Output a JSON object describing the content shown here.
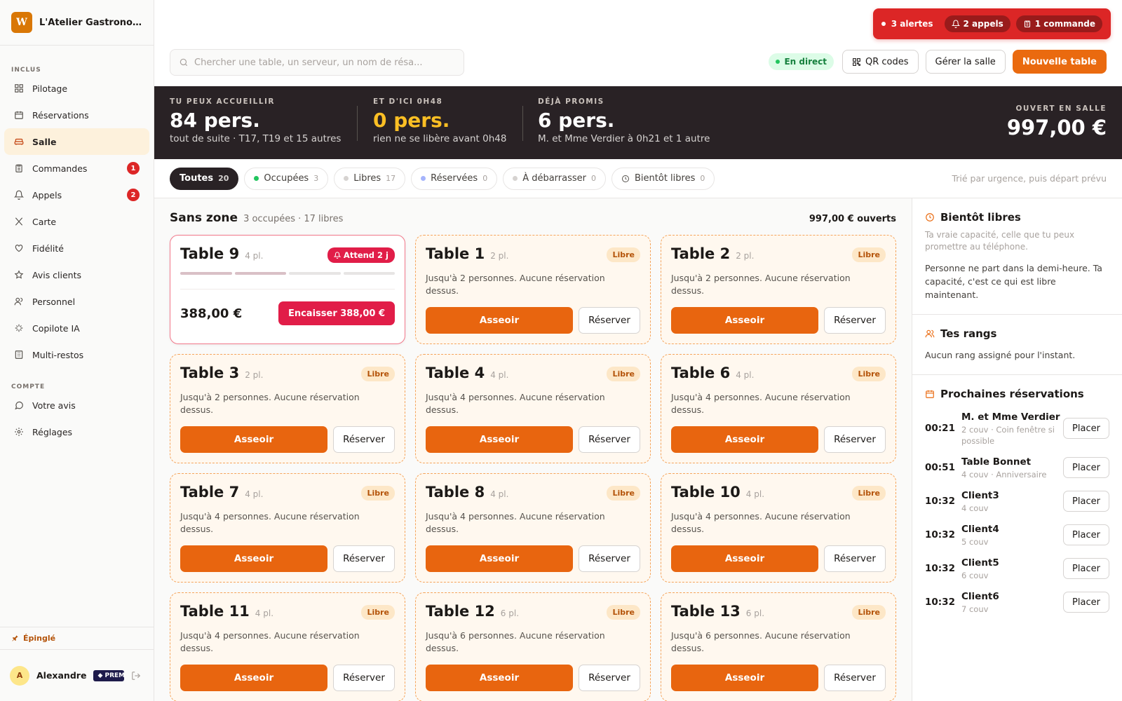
{
  "sidebar": {
    "brand_initial": "W",
    "brand_name": "L'Atelier Gastronomi...",
    "section_included": "INCLUS",
    "items": [
      {
        "label": "Pilotage",
        "icon": "dashboard-icon"
      },
      {
        "label": "Réservations",
        "icon": "calendar-icon"
      },
      {
        "label": "Salle",
        "icon": "sofa-icon"
      },
      {
        "label": "Commandes",
        "icon": "clipboard-icon",
        "badge": "1"
      },
      {
        "label": "Appels",
        "icon": "bell-icon",
        "badge": "2"
      },
      {
        "label": "Carte",
        "icon": "utensils-icon"
      },
      {
        "label": "Fidélité",
        "icon": "heart-icon"
      },
      {
        "label": "Avis clients",
        "icon": "star-icon"
      },
      {
        "label": "Personnel",
        "icon": "users-icon"
      },
      {
        "label": "Copilote IA",
        "icon": "sparkles-icon"
      },
      {
        "label": "Multi-restos",
        "icon": "building-icon"
      }
    ],
    "section_account": "COMPTE",
    "account_items": [
      {
        "label": "Votre avis",
        "icon": "message-icon"
      },
      {
        "label": "Réglages",
        "icon": "gear-icon"
      }
    ],
    "pinned_label": "Épinglé",
    "user_initial": "A",
    "user_name": "Alexandre",
    "plan_label": "◆ PREMIUM"
  },
  "topbar": {
    "alerts_label": "3 alertes",
    "calls_label": "2 appels",
    "orders_label": "1 commande",
    "search_placeholder": "Chercher une table, un serveur, un nom de résa...",
    "live_label": "En direct",
    "qr_label": "QR codes",
    "manage_label": "Gérer la salle",
    "new_table_label": "Nouvelle table"
  },
  "banner": {
    "s1_label": "TU PEUX ACCUEILLIR",
    "s1_value": "84 pers.",
    "s1_sub": "tout de suite · T17, T19 et 15 autres",
    "s2_label": "ET D'ICI 0H48",
    "s2_value": "0 pers.",
    "s2_sub": "rien ne se libère avant 0h48",
    "s3_label": "DÉJÀ PROMIS",
    "s3_value": "6 pers.",
    "s3_sub": "M. et Mme Verdier à 0h21 et 1 autre",
    "s4_label": "OUVERT EN SALLE",
    "s4_value": "997,00 €"
  },
  "filters": {
    "chips": [
      {
        "label": "Toutes",
        "count": "20",
        "active": true
      },
      {
        "label": "Occupées",
        "count": "3",
        "dot": "#22c55e"
      },
      {
        "label": "Libres",
        "count": "17",
        "dot": "#d6d3d1"
      },
      {
        "label": "Réservées",
        "count": "0",
        "dot": "#a5b4fc"
      },
      {
        "label": "À débarrasser",
        "count": "0",
        "dot": "#d6d3d1"
      },
      {
        "label": "Bientôt libres",
        "count": "0",
        "clock": true
      }
    ],
    "sort_note": "Trié par urgence, puis départ prévu"
  },
  "zone": {
    "title": "Sans zone",
    "meta": "3 occupées · 17 libres",
    "total": "997,00 € ouverts"
  },
  "occupied_table": {
    "name": "Table 9",
    "seats": "4 pl.",
    "wait_label": "Attend 2 j",
    "progress_steps_done": 2,
    "progress_steps_total": 4,
    "amount": "388,00 €",
    "cash_label": "Encaisser 388,00 €"
  },
  "free_labels": {
    "tag": "Libre",
    "seat": "Asseoir",
    "reserve": "Réserver"
  },
  "tables": [
    {
      "name": "Table 1",
      "seats": "2 pl.",
      "desc": "Jusqu'à 2 personnes. Aucune réservation dessus."
    },
    {
      "name": "Table 2",
      "seats": "2 pl.",
      "desc": "Jusqu'à 2 personnes. Aucune réservation dessus."
    },
    {
      "name": "Table 3",
      "seats": "2 pl.",
      "desc": "Jusqu'à 2 personnes. Aucune réservation dessus."
    },
    {
      "name": "Table 4",
      "seats": "4 pl.",
      "desc": "Jusqu'à 4 personnes. Aucune réservation dessus."
    },
    {
      "name": "Table 6",
      "seats": "4 pl.",
      "desc": "Jusqu'à 4 personnes. Aucune réservation dessus."
    },
    {
      "name": "Table 7",
      "seats": "4 pl.",
      "desc": "Jusqu'à 4 personnes. Aucune réservation dessus."
    },
    {
      "name": "Table 8",
      "seats": "4 pl.",
      "desc": "Jusqu'à 4 personnes. Aucune réservation dessus."
    },
    {
      "name": "Table 10",
      "seats": "4 pl.",
      "desc": "Jusqu'à 4 personnes. Aucune réservation dessus."
    },
    {
      "name": "Table 11",
      "seats": "4 pl.",
      "desc": "Jusqu'à 4 personnes. Aucune réservation dessus."
    },
    {
      "name": "Table 12",
      "seats": "6 pl.",
      "desc": "Jusqu'à 6 personnes. Aucune réservation dessus."
    },
    {
      "name": "Table 13",
      "seats": "6 pl.",
      "desc": "Jusqu'à 6 personnes. Aucune réservation dessus."
    }
  ],
  "right": {
    "soon_title": "Bientôt libres",
    "soon_sub": "Ta vraie capacité, celle que tu peux promettre au téléphone.",
    "soon_text": "Personne ne part dans la demi-heure. Ta capacité, c'est ce qui est libre maintenant.",
    "ranks_title": "Tes rangs",
    "ranks_text": "Aucun rang assigné pour l'instant.",
    "next_title": "Prochaines réservations",
    "place_label": "Placer",
    "reservations": [
      {
        "time": "00:21",
        "name": "M. et Mme Verdier",
        "meta": "2 couv · Coin fenêtre si possible"
      },
      {
        "time": "00:51",
        "name": "Table Bonnet",
        "meta": "4 couv · Anniversaire"
      },
      {
        "time": "10:32",
        "name": "Client3",
        "meta": "4 couv"
      },
      {
        "time": "10:32",
        "name": "Client4",
        "meta": "5 couv"
      },
      {
        "time": "10:32",
        "name": "Client5",
        "meta": "6 couv"
      },
      {
        "time": "10:32",
        "name": "Client6",
        "meta": "7 couv"
      }
    ]
  },
  "colors": {
    "accent": "#ea6a0f",
    "danger": "#dc2626",
    "banner_bg": "#292225"
  }
}
